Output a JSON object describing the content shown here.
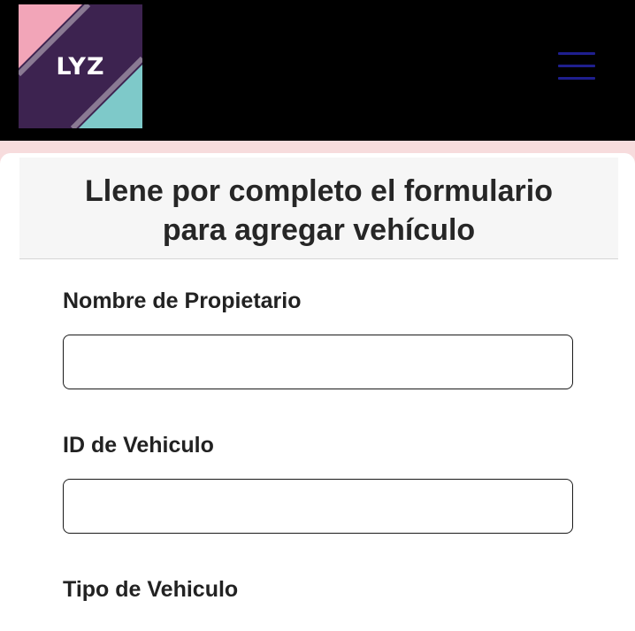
{
  "header": {
    "logo_text": "LYZ",
    "menu_icon": "hamburger-menu-icon"
  },
  "form": {
    "title_line1": "Llene por completo el formulario",
    "title_line2": "para agregar vehículo",
    "fields": [
      {
        "label": "Nombre de Propietario",
        "value": ""
      },
      {
        "label": "ID de Vehiculo",
        "value": ""
      },
      {
        "label": "Tipo de Vehiculo"
      }
    ]
  },
  "colors": {
    "topbar": "#000000",
    "logo_purple": "#3d2350",
    "logo_pink": "#f2a5b8",
    "logo_teal": "#7ec9c9",
    "menu_icon": "#1f1f8f",
    "page_background": "#f7dcdd"
  }
}
